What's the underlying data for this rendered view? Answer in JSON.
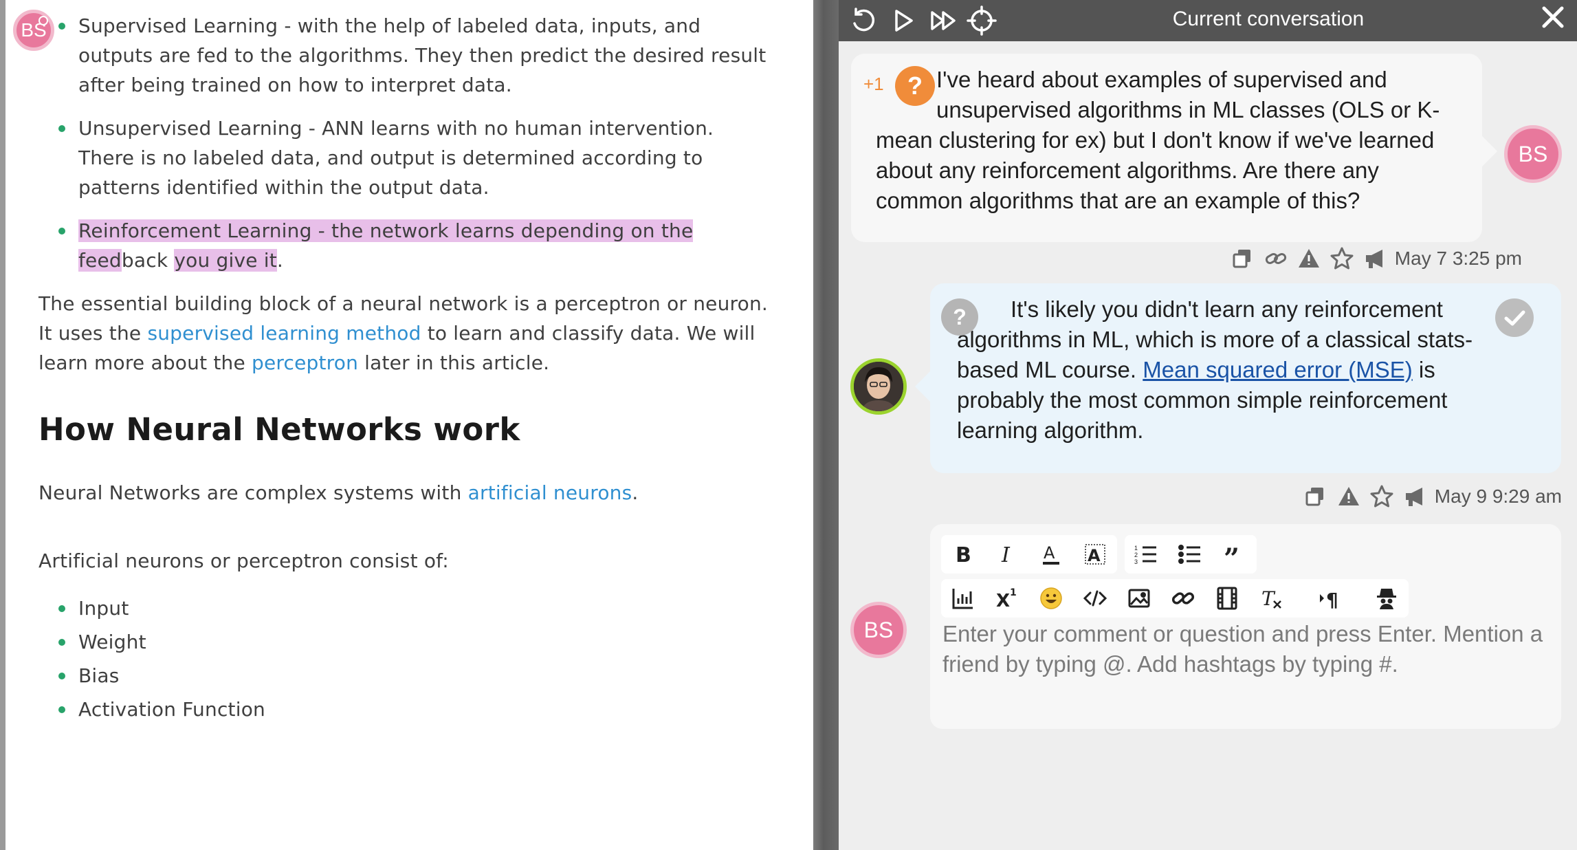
{
  "article": {
    "author_initials": "BS",
    "bullets": [
      {
        "text": "Supervised Learning - with the help of labeled data, inputs, and outputs are fed to the algorithms. They then predict the desired result after being trained on how to interpret data."
      },
      {
        "text": "Unsupervised Learning - ANN learns with no human intervention. There is no labeled data, and output is determined according to patterns identified within the output data."
      }
    ],
    "reinforcement": {
      "highlighted": "Reinforcement Learning - the network learns depending on the feed",
      "after": "back ",
      "highlighted_2": "you give it",
      "end": "."
    },
    "paragraph": {
      "p1": "The essential building block of a neural network is a perceptron or neuron. It uses the ",
      "link1": "supervised learning method",
      "p2": " to learn and classify data. We will learn more about the ",
      "link2": "perceptron",
      "p3": " later in this article."
    },
    "heading": "How Neural Networks work",
    "nn_line": {
      "text": "Neural Networks are complex systems with ",
      "link": "artificial neurons",
      "end": "."
    },
    "consist_line": "Artificial neurons or perceptron consist of:",
    "components": [
      "Input",
      "Weight",
      "Bias",
      "Activation Function"
    ]
  },
  "panel": {
    "title": "Current conversation",
    "toolbar_icons": [
      "undo-icon",
      "play-icon",
      "fast-forward-icon",
      "crosshair-icon",
      "close-icon"
    ],
    "question": {
      "upvote": "+1",
      "badge": "?",
      "text": "I've heard about examples of supervised and unsupervised algorithms in ML classes (OLS or K-mean clustering for ex) but I don't know if we've learned about any reinforcement algorithms. Are there any common algorithms that are an example of this?",
      "author_initials": "BS",
      "timestamp": "May 7 3:25 pm",
      "color": "#f08c3a"
    },
    "answer": {
      "badge": "?",
      "text_before": "It's likely you didn't learn any reinforcement algorithms in ML, which is more of a classical stats-based ML course. ",
      "link": "Mean squared error (MSE)",
      "text_after": " is probably the most common simple reinforcement learning algorithm.",
      "timestamp": "May 9 9:29 am"
    },
    "editor": {
      "author_initials": "BS",
      "placeholder": "Enter your comment or question and press Enter. Mention a friend by typing @. Add hashtags by typing #.",
      "value": ""
    }
  },
  "colors": {
    "bullet_dot": "#28a36a",
    "link": "#2f8fd0",
    "highlight": "#e8bfe9",
    "avatar_pink": "#e8789c",
    "topbar": "#545454",
    "answer_bubble": "#eaf4fb"
  }
}
